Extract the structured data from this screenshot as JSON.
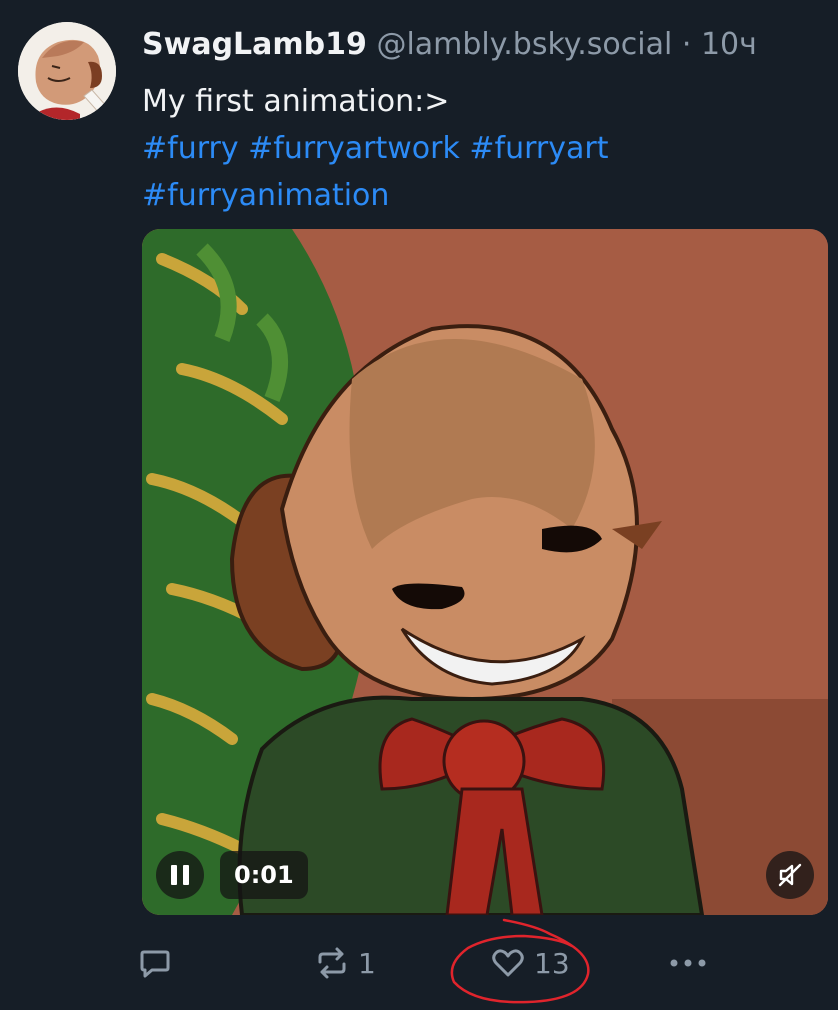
{
  "post": {
    "author_name": "SwagLamb19",
    "author_handle": "@lambly.bsky.social",
    "separator": "·",
    "time": "10ч",
    "text_line": "My first animation:>",
    "hashtags": [
      "#furry",
      "#furryartwork",
      "#furryart",
      "#furryanimation"
    ]
  },
  "media": {
    "elapsed": "0:01",
    "pause_icon": "pause-icon",
    "mute_icon": "speaker-muted-icon"
  },
  "actions": {
    "reply_icon": "reply-bubble-icon",
    "repost_icon": "repost-icon",
    "repost_count": "1",
    "like_icon": "heart-icon",
    "like_count": "13",
    "more_icon": "ellipsis-icon"
  },
  "colors": {
    "background": "#161e27",
    "hashtag": "#2c8bf6",
    "muted_text": "#8d9aa8",
    "annotation_circle": "#e0242c"
  }
}
